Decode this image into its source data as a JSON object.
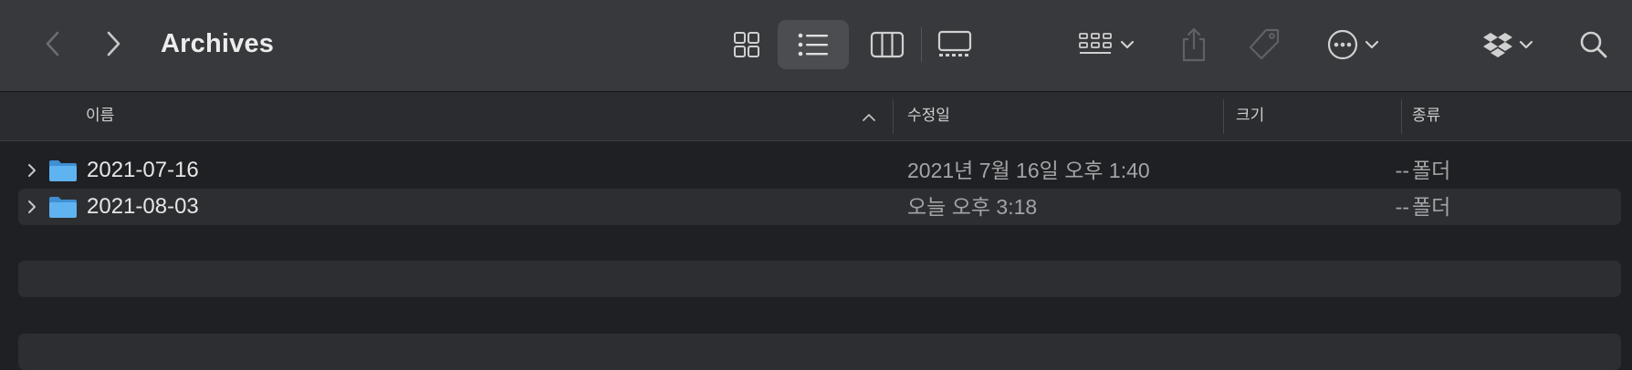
{
  "window": {
    "title": "Archives"
  },
  "toolbar": {
    "back_icon": "chevron-left-icon",
    "forward_icon": "chevron-right-icon",
    "view_modes": [
      {
        "name": "icon-view",
        "icon": "grid-icon",
        "selected": false
      },
      {
        "name": "list-view",
        "icon": "list-icon",
        "selected": true
      },
      {
        "name": "column-view",
        "icon": "columns-icon",
        "selected": false
      },
      {
        "name": "gallery-view",
        "icon": "gallery-icon",
        "selected": false
      }
    ],
    "group_icon": "group-by-icon",
    "share_icon": "share-icon",
    "tag_icon": "tag-icon",
    "action_icon": "ellipsis-circle-icon",
    "dropbox_icon": "dropbox-icon",
    "search_icon": "search-icon"
  },
  "columns": {
    "name": "이름",
    "date": "수정일",
    "size": "크기",
    "kind": "종류",
    "sort_column": "name",
    "sort_direction": "ascending"
  },
  "rows": [
    {
      "name": "2021-07-16",
      "date": "2021년 7월 16일 오후 1:40",
      "size": "--",
      "kind": "폴더"
    },
    {
      "name": "2021-08-03",
      "date": "오늘 오후 3:18",
      "size": "--",
      "kind": "폴더"
    }
  ],
  "colors": {
    "toolbar_bg": "#38393c",
    "list_bg": "#1f2023",
    "stripe_bg": "#2d2e31",
    "folder_blue": "#5fb3f0"
  }
}
